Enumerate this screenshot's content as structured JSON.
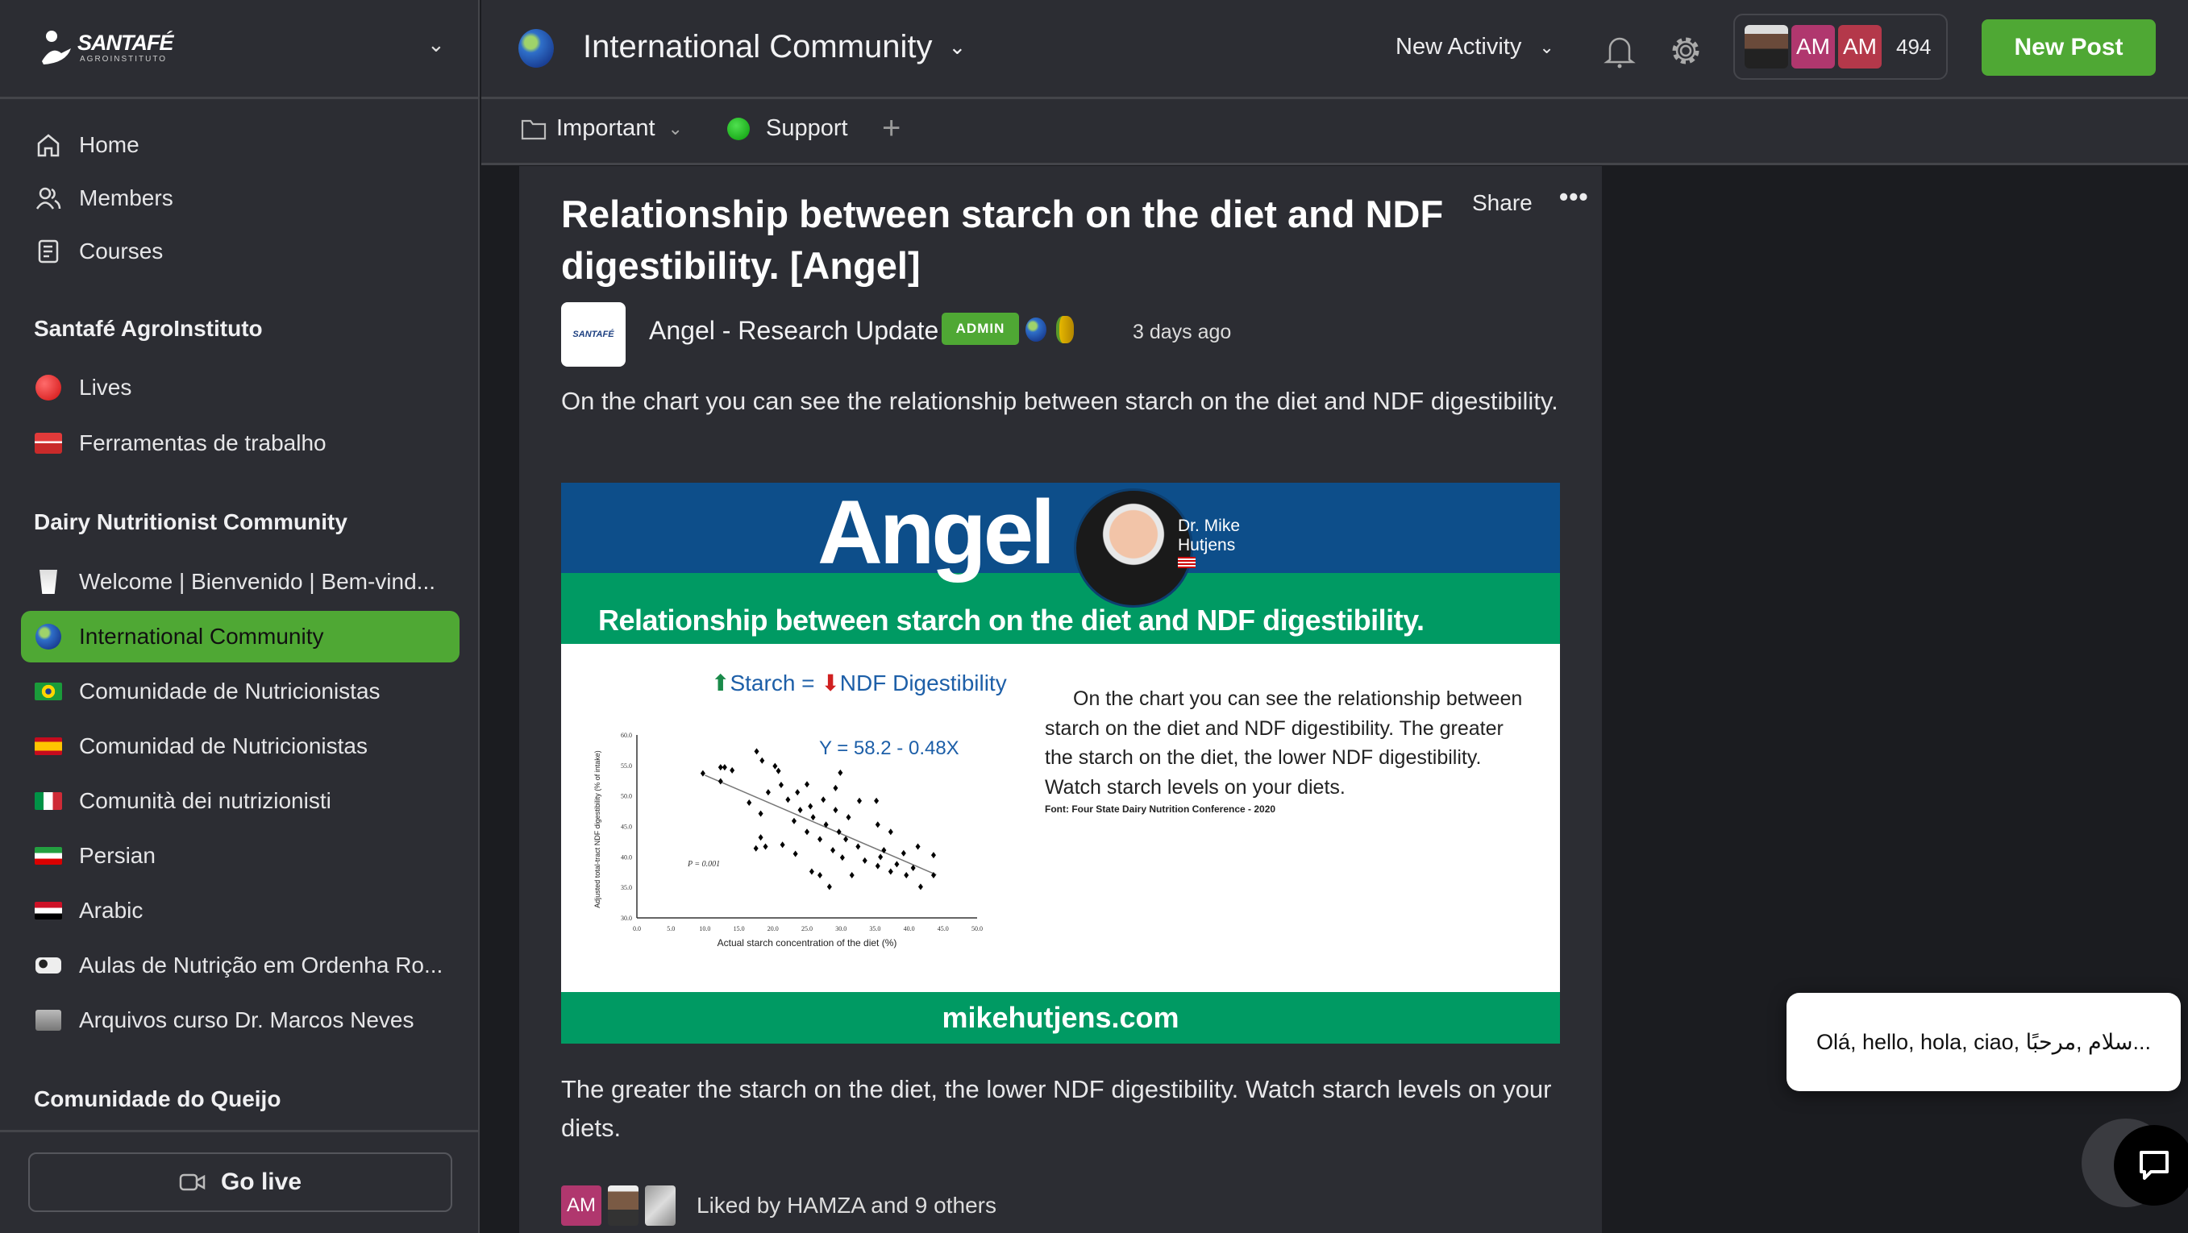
{
  "sidebar": {
    "brand": {
      "name": "SANTAFÉ",
      "tagline": "AGROINSTITUTO"
    },
    "nav": [
      {
        "label": "Home",
        "icon": "home-icon"
      },
      {
        "label": "Members",
        "icon": "members-icon"
      },
      {
        "label": "Courses",
        "icon": "courses-icon"
      }
    ],
    "sections": [
      {
        "title": "Santafé AgroInstituto",
        "items": [
          {
            "label": "Lives",
            "icon": "red-circle-icon"
          },
          {
            "label": "Ferramentas de trabalho",
            "icon": "toolbox-icon"
          }
        ]
      },
      {
        "title": "Dairy Nutritionist Community",
        "items": [
          {
            "label": "Welcome | Bienvenido | Bem-vind...",
            "icon": "milk-glass-icon"
          },
          {
            "label": "International Community",
            "icon": "globe-icon",
            "active": true
          },
          {
            "label": "Comunidade de Nutricionistas",
            "icon": "brazil-flag-icon"
          },
          {
            "label": "Comunidad de Nutricionistas",
            "icon": "spain-flag-icon"
          },
          {
            "label": "Comunità dei nutrizionisti",
            "icon": "italy-flag-icon"
          },
          {
            "label": "Persian",
            "icon": "iran-flag-icon"
          },
          {
            "label": "Arabic",
            "icon": "egypt-flag-icon"
          },
          {
            "label": "Aulas de Nutrição em Ordenha Ro...",
            "icon": "cow-icon"
          },
          {
            "label": "Arquivos curso Dr. Marcos Neves",
            "icon": "folder-icon"
          }
        ]
      },
      {
        "title": "Comunidade do Queijo",
        "items": []
      }
    ],
    "go_live": "Go live"
  },
  "header": {
    "title": "International Community",
    "new_activity": "New Activity",
    "members": {
      "avatars": [
        "AM",
        "AM"
      ],
      "count": "494"
    },
    "new_post": "New Post"
  },
  "subnav": {
    "items": [
      "Important",
      "Support"
    ]
  },
  "post": {
    "title": "Relationship between starch on the diet and NDF digestibility. [Angel]",
    "share": "Share",
    "author": "Angel - Research Update",
    "badge": "ADMIN",
    "time": "3 days ago",
    "body1": "On the chart you can see the relationship between  starch on the diet and NDF digestibility.",
    "body2": "The greater the  starch on the diet, the lower NDF digestibility. Watch  starch levels on your diets.",
    "likes": {
      "avatar": "AM",
      "text": "Liked by HAMZA and 9 others"
    },
    "image": {
      "brand": "Angel",
      "person": "Dr. Mike Hutjens",
      "heading": "Relationship between starch on the diet and NDF digestibility.",
      "chart_title_a": "Starch = ",
      "chart_title_b": "NDF Digestibility",
      "desc": [
        "On the chart you can see the relationship between",
        "starch on the diet and NDF digestibility. The greater",
        "the  starch on the diet, the lower NDF digestibility.",
        "Watch  starch levels on your diets."
      ],
      "source": "Font: Four State Dairy Nutrition Conference - 2020",
      "url": "mikehutjens.com",
      "colors": {
        "blue": "#0d4e8a",
        "green": "#009a63"
      }
    }
  },
  "chat": {
    "greeting": "Olá, hello, hola, ciao, سلام ,مرحبًا..."
  },
  "colors": {
    "accent": "#4fa834",
    "background": "#2c2d33"
  },
  "chart_data": {
    "type": "scatter",
    "title": "Starch = NDF Digestibility",
    "equation": "Y = 58.2 - 0.48X",
    "annotation": "P = 0.001",
    "xlabel": "Actual starch concentration of the diet (%)",
    "ylabel": "Adjusted total-tract NDF digestibility (% of intake)",
    "xlim": [
      0,
      50
    ],
    "ylim": [
      30,
      60
    ],
    "xticks": [
      "0.0",
      "5.0",
      "10.0",
      "15.0",
      "20.0",
      "25.0",
      "30.0",
      "35.0",
      "40.0",
      "45.0",
      "50.0"
    ],
    "yticks": [
      "30.0",
      "35.0",
      "40.0",
      "45.0",
      "50.0",
      "55.0",
      "60.0"
    ],
    "trendline": {
      "intercept": 58.2,
      "slope": -0.48,
      "x_range": [
        10,
        44
      ]
    },
    "points": [
      [
        9.7,
        53.7
      ],
      [
        12.3,
        54.7
      ],
      [
        12.9,
        54.7
      ],
      [
        14.0,
        54.2
      ],
      [
        12.3,
        52.4
      ],
      [
        17.6,
        57.3
      ],
      [
        18.4,
        55.8
      ],
      [
        20.3,
        54.9
      ],
      [
        20.8,
        54.1
      ],
      [
        16.5,
        48.9
      ],
      [
        18.2,
        47.1
      ],
      [
        17.5,
        41.4
      ],
      [
        18.9,
        41.7
      ],
      [
        18.2,
        43.2
      ],
      [
        21.4,
        42.0
      ],
      [
        23.3,
        40.5
      ],
      [
        25.0,
        51.9
      ],
      [
        29.2,
        51.3
      ],
      [
        29.9,
        53.8
      ],
      [
        32.7,
        49.2
      ],
      [
        35.2,
        49.2
      ],
      [
        35.4,
        45.3
      ],
      [
        37.3,
        44.1
      ],
      [
        41.3,
        41.7
      ],
      [
        43.6,
        40.3
      ],
      [
        43.6,
        37.0
      ],
      [
        41.7,
        35.1
      ],
      [
        28.3,
        35.1
      ],
      [
        25.7,
        37.6
      ],
      [
        26.9,
        37.0
      ],
      [
        31.6,
        37.0
      ],
      [
        33.5,
        39.4
      ],
      [
        35.8,
        40.0
      ],
      [
        38.2,
        38.8
      ],
      [
        39.6,
        37.0
      ],
      [
        39.2,
        40.6
      ],
      [
        22.2,
        49.4
      ],
      [
        24.0,
        47.7
      ],
      [
        25.9,
        46.5
      ],
      [
        27.8,
        45.3
      ],
      [
        29.7,
        44.1
      ],
      [
        30.7,
        42.9
      ],
      [
        32.5,
        41.7
      ],
      [
        21.2,
        51.8
      ],
      [
        19.3,
        50.6
      ],
      [
        23.1,
        45.9
      ],
      [
        25.0,
        44.1
      ],
      [
        26.9,
        42.9
      ],
      [
        28.8,
        41.1
      ],
      [
        30.2,
        39.9
      ],
      [
        27.4,
        49.4
      ],
      [
        29.2,
        47.7
      ],
      [
        31.1,
        46.5
      ],
      [
        25.5,
        48.3
      ],
      [
        23.6,
        50.6
      ],
      [
        37.3,
        37.6
      ],
      [
        35.4,
        38.5
      ],
      [
        36.3,
        41.1
      ],
      [
        40.6,
        38.2
      ]
    ]
  }
}
